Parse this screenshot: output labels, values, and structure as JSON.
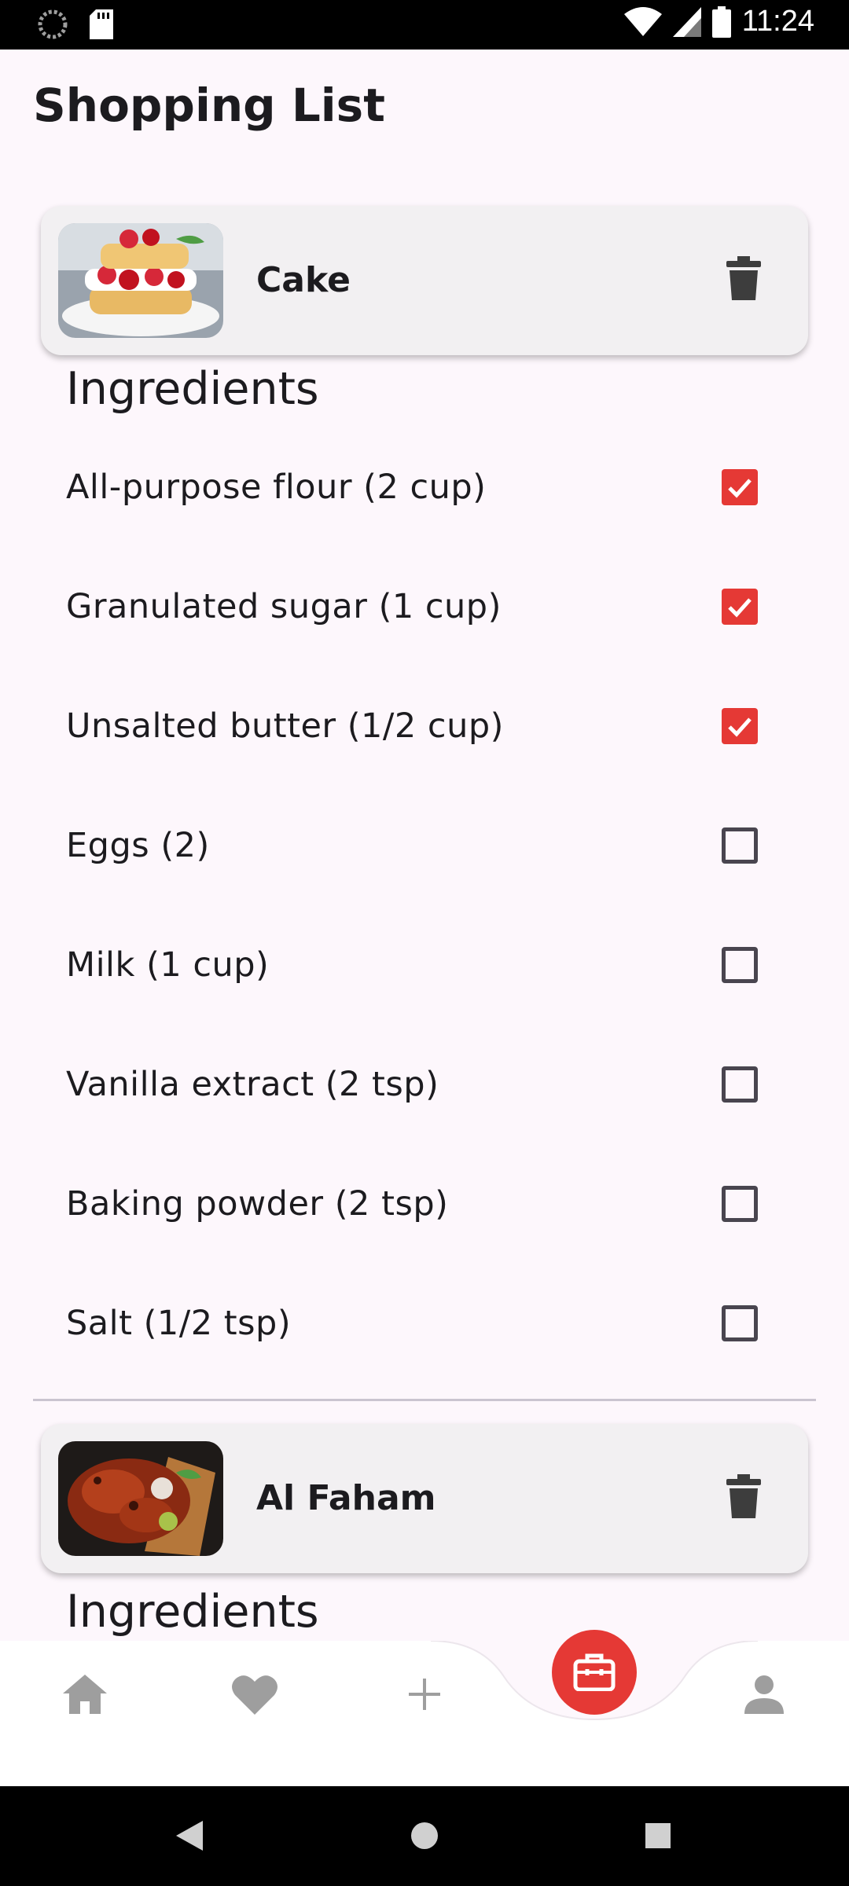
{
  "status_bar": {
    "time": "11:24",
    "icons": [
      "loading-icon",
      "sd-card-icon",
      "wifi-icon",
      "signal-icon",
      "battery-icon"
    ]
  },
  "page": {
    "title": "Shopping List"
  },
  "recipes": [
    {
      "name": "Cake",
      "image": "strawberry-shortcake-photo",
      "section_heading": "Ingredients",
      "ingredients": [
        {
          "label": "All-purpose flour (2 cup)",
          "checked": true
        },
        {
          "label": "Granulated sugar (1 cup)",
          "checked": true
        },
        {
          "label": "Unsalted butter (1/2 cup)",
          "checked": true
        },
        {
          "label": "Eggs (2)",
          "checked": false
        },
        {
          "label": "Milk (1 cup)",
          "checked": false
        },
        {
          "label": "Vanilla extract (2 tsp)",
          "checked": false
        },
        {
          "label": "Baking powder (2 tsp)",
          "checked": false
        },
        {
          "label": "Salt (1/2 tsp)",
          "checked": false
        }
      ]
    },
    {
      "name": "Al Faham",
      "image": "grilled-chicken-photo",
      "section_heading": "Ingredients"
    }
  ],
  "bottom_nav": {
    "items": [
      "home-icon",
      "heart-icon",
      "add-icon",
      "briefcase-icon",
      "person-icon"
    ],
    "active": "briefcase-icon"
  },
  "colors": {
    "accent": "#E53935",
    "background": "#FDF7FC",
    "card": "#F2F0F2"
  }
}
